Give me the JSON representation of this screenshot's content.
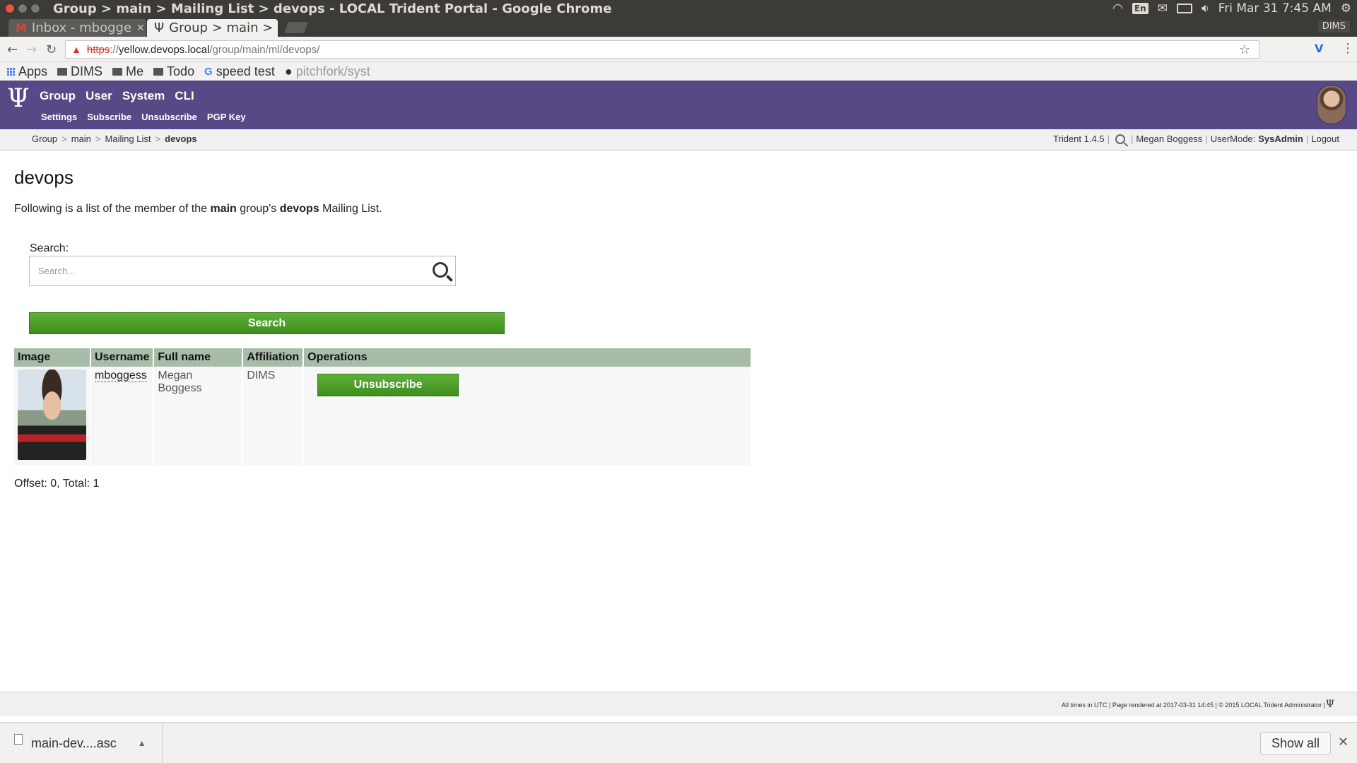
{
  "os": {
    "window_title": "Group > main > Mailing List > devops - LOCAL Trident Portal - Google Chrome",
    "keyboard_layout": "En",
    "datetime": "Fri Mar 31  7:45 AM"
  },
  "browser": {
    "tabs": [
      {
        "label": "Inbox - mbogge",
        "icon": "gmail-icon"
      },
      {
        "label": "Group > main >",
        "icon": "trident-icon"
      }
    ],
    "profile_badge": "DIMS",
    "url": {
      "scheme": "https",
      "separator": "://",
      "host": "yellow.devops.local",
      "path": "/group/main/ml/devops/"
    },
    "bookmarks": [
      {
        "label": "Apps",
        "icon": "apps-grid-icon"
      },
      {
        "label": "DIMS",
        "icon": "folder-icon"
      },
      {
        "label": "Me",
        "icon": "folder-icon"
      },
      {
        "label": "Todo",
        "icon": "folder-icon"
      },
      {
        "label": "speed test",
        "icon": "google-icon"
      },
      {
        "label": "pitchfork/syst",
        "icon": "github-icon"
      }
    ]
  },
  "trident": {
    "main_nav": [
      "Group",
      "User",
      "System",
      "CLI"
    ],
    "sub_nav": [
      "Settings",
      "Subscribe",
      "Unsubscribe",
      "PGP Key"
    ],
    "breadcrumb": [
      "Group",
      "main",
      "Mailing List",
      "devops"
    ],
    "version": "Trident 1.4.5",
    "user_name": "Megan Boggess",
    "usermode_label": "UserMode:",
    "usermode_value": "SysAdmin",
    "logout": "Logout",
    "header_color": "#574886"
  },
  "page": {
    "title": "devops",
    "intro_prefix": "Following is a list of the member of the",
    "intro_group": "main",
    "intro_middle": "group's",
    "intro_list": "devops",
    "intro_suffix": "Mailing List.",
    "search_label": "Search:",
    "search_placeholder": "Search...",
    "search_button": "Search",
    "table": {
      "headers": [
        "Image",
        "Username",
        "Full name",
        "Affiliation",
        "Operations"
      ],
      "rows": [
        {
          "username": "mboggess",
          "full_name": "Megan Boggess",
          "affiliation": "DIMS",
          "operation": "Unsubscribe"
        }
      ]
    },
    "offset_text": "Offset: 0, Total: 1"
  },
  "footer": {
    "text": "All times in UTC | Page rendered at 2017-03-31 14:45 | © 2015 LOCAL Trident Administrator |"
  },
  "downloads": {
    "file": "main-dev....asc",
    "show_all": "Show all"
  }
}
